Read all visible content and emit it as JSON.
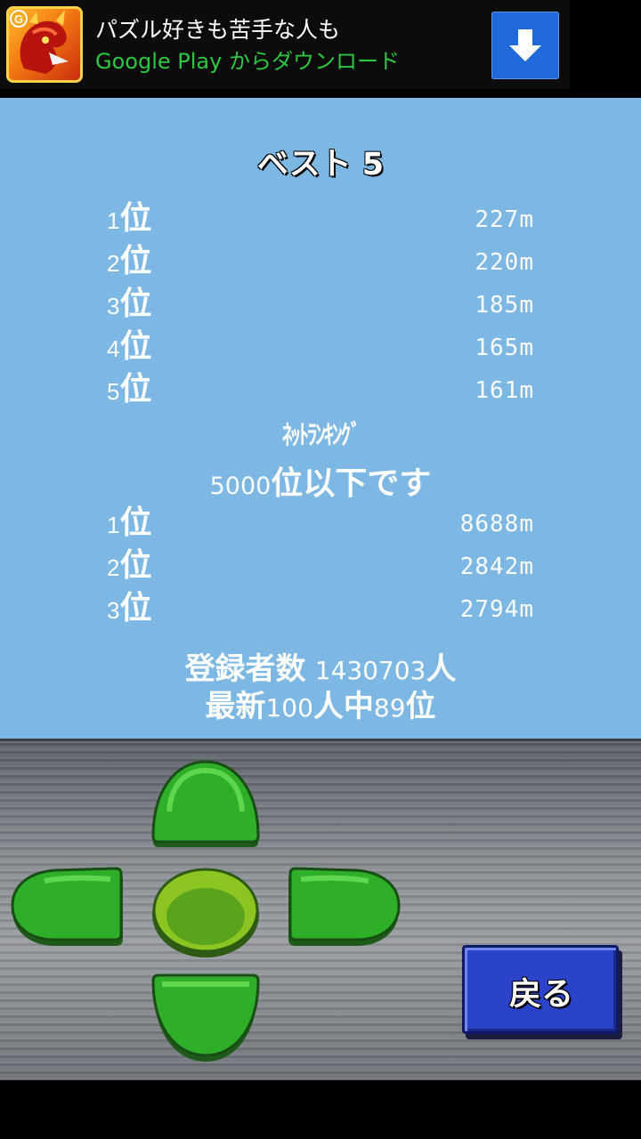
{
  "ad": {
    "title": "パズル好きも苦手な人も",
    "subtitle": "Google Play からダウンロード",
    "icon": "dragon-app-icon",
    "download_icon": "download-arrow-icon"
  },
  "best": {
    "title": "ベスト 5",
    "rows": [
      {
        "num": "1",
        "suffix": "位",
        "distance": "227m"
      },
      {
        "num": "2",
        "suffix": "位",
        "distance": "220m"
      },
      {
        "num": "3",
        "suffix": "位",
        "distance": "185m"
      },
      {
        "num": "4",
        "suffix": "位",
        "distance": "165m"
      },
      {
        "num": "5",
        "suffix": "位",
        "distance": "161m"
      }
    ]
  },
  "net": {
    "heading": "ﾈｯﾄﾗﾝｷﾝｸﾞ",
    "status_num": "5000",
    "status_text": "位以下です",
    "rows": [
      {
        "num": "1",
        "suffix": "位",
        "distance": "8688m"
      },
      {
        "num": "2",
        "suffix": "位",
        "distance": "2842m"
      },
      {
        "num": "3",
        "suffix": "位",
        "distance": "2794m"
      }
    ]
  },
  "stats": {
    "registered_label": "登録者数",
    "registered_count": "1430703",
    "registered_unit": "人",
    "recent_prefix": "最新",
    "recent_num": "100",
    "recent_mid": "人中",
    "recent_rank": "89",
    "recent_suffix": "位"
  },
  "controls": {
    "back_label": "戻る",
    "dpad": [
      "dpad-up",
      "dpad-left",
      "dpad-center",
      "dpad-right",
      "dpad-down"
    ]
  },
  "colors": {
    "panel_bg": "#7db7e3",
    "dpad_green": "#2fae2a",
    "dpad_center": "#8cc422",
    "back_button": "#2a43c9"
  }
}
